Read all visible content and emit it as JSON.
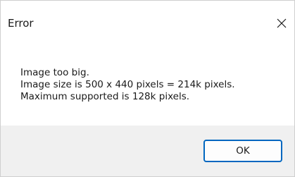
{
  "dialog": {
    "title": "Error",
    "close_icon": "close-icon",
    "message_lines": [
      "Image too big.",
      "Image size is 500 x 440 pixels = 214k pixels.",
      "Maximum supported is 128k pixels."
    ],
    "ok_label": "OK",
    "accent_color": "#0067c0"
  }
}
